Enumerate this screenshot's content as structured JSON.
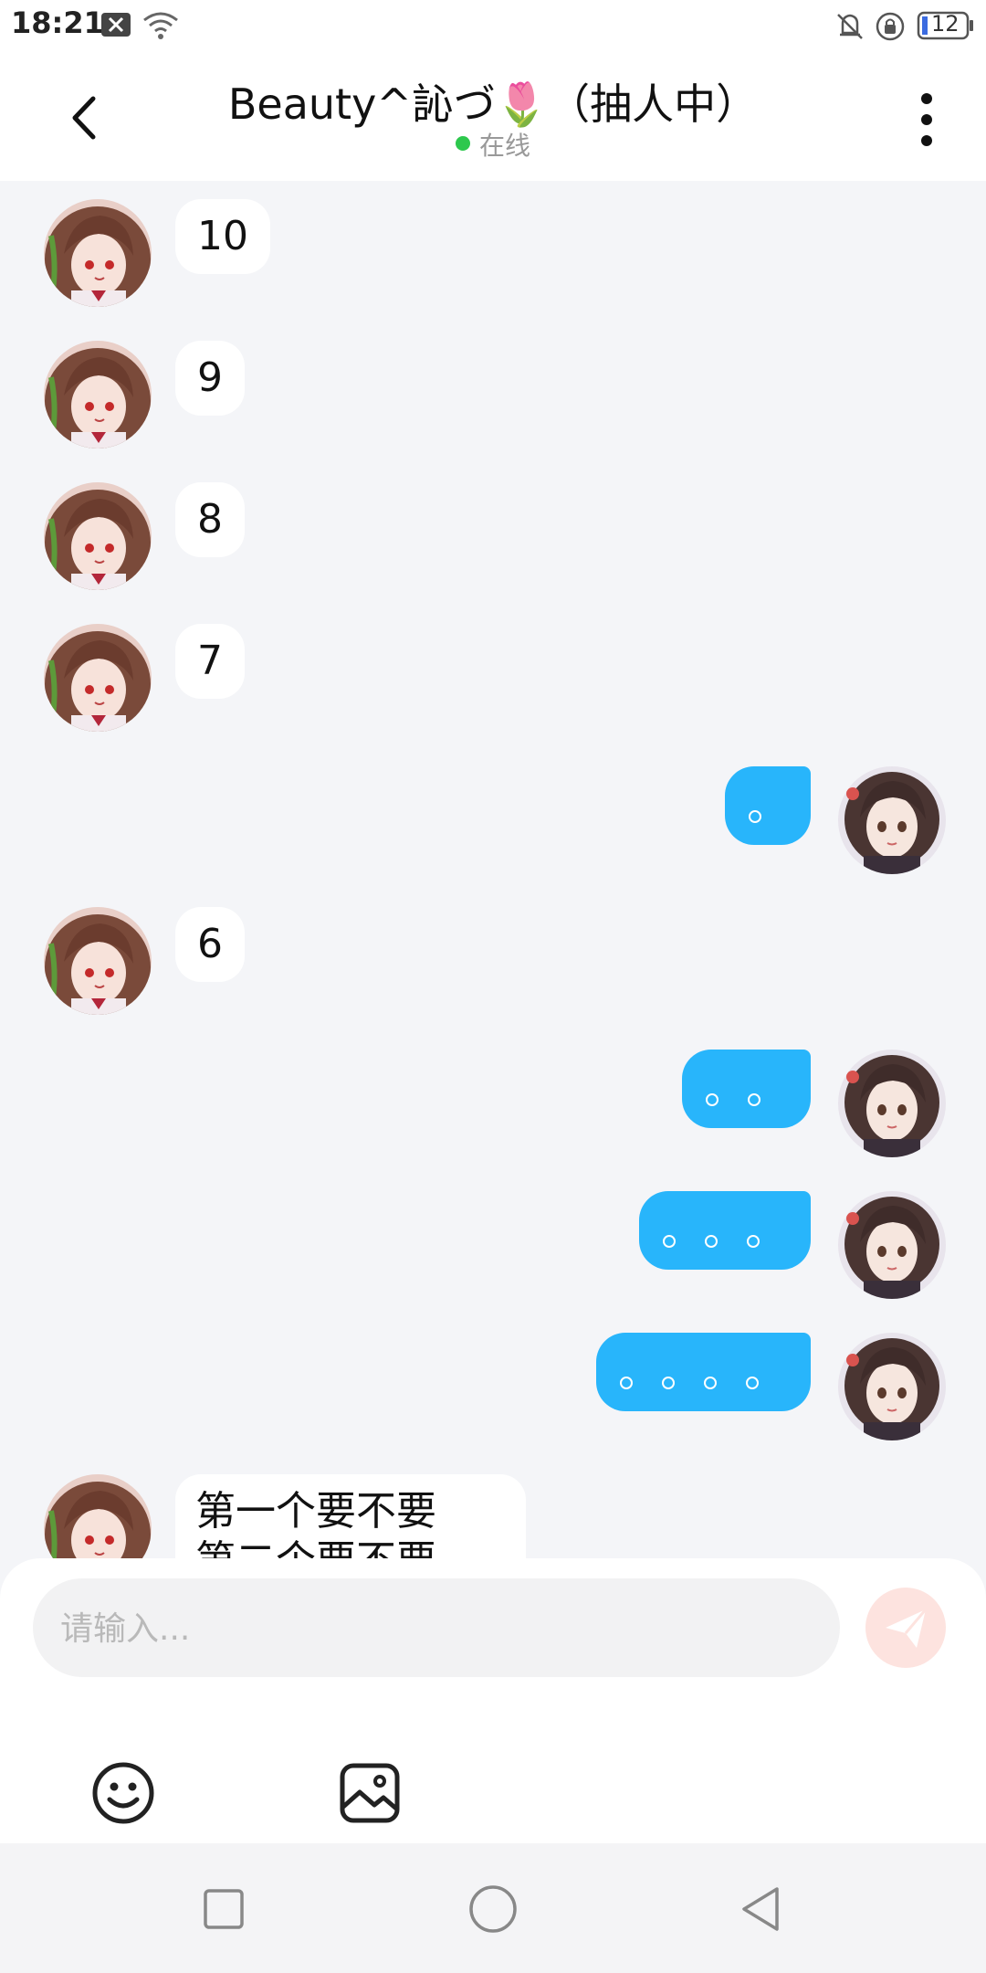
{
  "status_bar": {
    "time": "18:21",
    "battery": "12",
    "icons": [
      "close-box-icon",
      "wifi-icon",
      "bell-off-icon",
      "rotation-lock-icon",
      "battery-icon"
    ]
  },
  "header": {
    "title": "Beauty^訫づ🌷（抽人中）",
    "status": "在线",
    "icons": [
      "back-arrow-icon",
      "more-vertical-icon"
    ]
  },
  "messages": [
    {
      "side": "in",
      "text": "10"
    },
    {
      "side": "in",
      "text": "9"
    },
    {
      "side": "in",
      "text": "8"
    },
    {
      "side": "in",
      "text": "7"
    },
    {
      "side": "out",
      "text": "。"
    },
    {
      "side": "in",
      "text": "6"
    },
    {
      "side": "out",
      "text": "。。"
    },
    {
      "side": "out",
      "text": "。。。"
    },
    {
      "side": "out",
      "text": "。。。。"
    },
    {
      "side": "in",
      "text": "第一个要不要\n第二个要不要"
    }
  ],
  "composer": {
    "placeholder": "请输入...",
    "icons": [
      "send-icon",
      "emoji-icon",
      "image-icon"
    ]
  },
  "nav_bar": {
    "icons": [
      "recent-apps-icon",
      "home-icon",
      "back-triangle-icon"
    ]
  },
  "colors": {
    "outgoing_bubble": "#28b5fb",
    "online_dot": "#2dc84d",
    "send_button": "#fde3df"
  }
}
